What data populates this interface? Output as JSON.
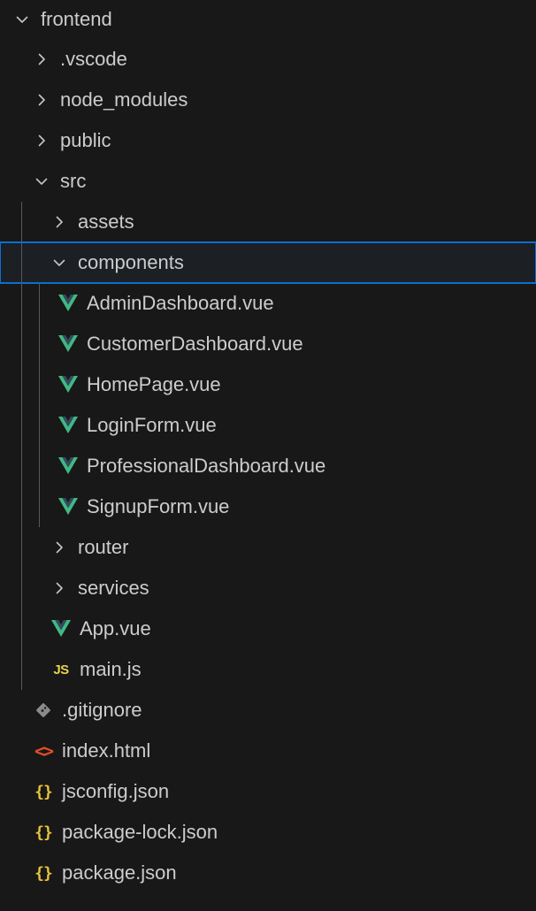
{
  "explorer": {
    "items": [
      {
        "label": "frontend",
        "depth": 0,
        "kind": "folder",
        "expanded": true
      },
      {
        "label": ".vscode",
        "depth": 1,
        "kind": "folder",
        "expanded": false
      },
      {
        "label": "node_modules",
        "depth": 1,
        "kind": "folder",
        "expanded": false
      },
      {
        "label": "public",
        "depth": 1,
        "kind": "folder",
        "expanded": false
      },
      {
        "label": "src",
        "depth": 1,
        "kind": "folder",
        "expanded": true
      },
      {
        "label": "assets",
        "depth": 2,
        "kind": "folder",
        "expanded": false
      },
      {
        "label": "components",
        "depth": 2,
        "kind": "folder",
        "expanded": true,
        "focused": true
      },
      {
        "label": "AdminDashboard.vue",
        "depth": 3,
        "kind": "vue"
      },
      {
        "label": "CustomerDashboard.vue",
        "depth": 3,
        "kind": "vue"
      },
      {
        "label": "HomePage.vue",
        "depth": 3,
        "kind": "vue"
      },
      {
        "label": "LoginForm.vue",
        "depth": 3,
        "kind": "vue"
      },
      {
        "label": "ProfessionalDashboard.vue",
        "depth": 3,
        "kind": "vue"
      },
      {
        "label": "SignupForm.vue",
        "depth": 3,
        "kind": "vue"
      },
      {
        "label": "router",
        "depth": 2,
        "kind": "folder",
        "expanded": false
      },
      {
        "label": "services",
        "depth": 2,
        "kind": "folder",
        "expanded": false
      },
      {
        "label": "App.vue",
        "depth": 2,
        "kind": "vue"
      },
      {
        "label": "main.js",
        "depth": 2,
        "kind": "js"
      },
      {
        "label": ".gitignore",
        "depth": 1,
        "kind": "git"
      },
      {
        "label": "index.html",
        "depth": 1,
        "kind": "html"
      },
      {
        "label": "jsconfig.json",
        "depth": 1,
        "kind": "json"
      },
      {
        "label": "package-lock.json",
        "depth": 1,
        "kind": "json"
      },
      {
        "label": "package.json",
        "depth": 1,
        "kind": "json"
      }
    ]
  },
  "icons": {
    "js": "JS",
    "json": "{}",
    "html": "<>"
  },
  "colors": {
    "background": "#181818",
    "text": "#cccccc",
    "focus_border": "#0a6fcf",
    "vue_green": "#41b883",
    "vue_dark": "#35495e",
    "js_yellow": "#e8d44d",
    "json_yellow": "#e8c33a",
    "html_orange": "#e44d26",
    "git_gray": "#8a8a8a",
    "indent_guide": "#585858"
  }
}
